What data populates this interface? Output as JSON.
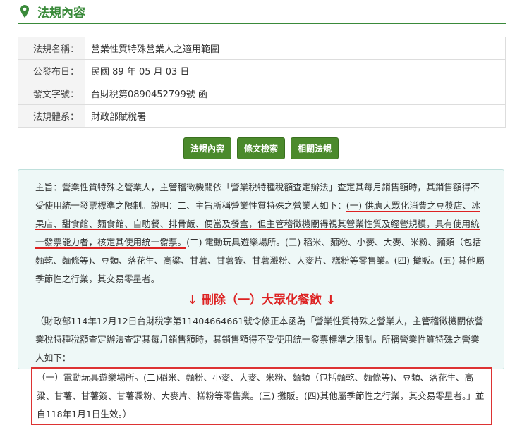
{
  "header": {
    "title": "法規內容",
    "icon": "map-pin-icon"
  },
  "info": [
    {
      "label": "法規名稱：",
      "value": "營業性質特殊營業人之適用範圍"
    },
    {
      "label": "公發布日：",
      "value": "民國 89 年 05 月 03 日"
    },
    {
      "label": "發文字號：",
      "value": "台財稅第0890452799號 函"
    },
    {
      "label": "法規體系：",
      "value": "財政部賦稅署"
    }
  ],
  "buttons": [
    "法規內容",
    "條文檢索",
    "相關法規"
  ],
  "content": {
    "p1a": "主旨：營業性質特殊之營業人，主管稽徵機關依「營業稅特種稅額查定辦法」查定其每月銷售額時，其銷售額得不受使用統一發票標準之限制。說明：二、主旨所稱營業性質特殊之營業人如下：",
    "p1u": "(一) 供應大眾化消費之豆漿店、冰果店、甜食館、麵食館、自助餐、排骨飯、便當及餐盒，但主管稽徵機關得視其營業性質及經營規模，具有使用統一發票能力者，核定其使用統一發票。",
    "p1b": "(二) 電動玩具遊樂場所。(三) 稻米、麵粉、小麥、大麥、米粉、麵類（包括麵乾、麵條等)、豆類、落花生、高粱、甘薯、甘薯簽、甘薯澱粉、大麥片、糕粉等零售業。(四) 攤販。(五) 其他屬季節性之行業，其交易零星者。",
    "annotation": "↓ 刪除（一）大眾化餐飲 ↓",
    "p2a": "（財政部114年12月12日台財稅字第11404664661號令修正本函為「營業性質特殊之營業人，主管稽徵機關依營業稅特種稅額查定辦法查定其每月銷售額時，其銷售額得不受使用統一發票標準之限制。所稱營業性質特殊之營業人如下：",
    "p2box": "（一）電動玩具遊樂場所。(二)稻米、麵粉、小麥、大麥、米粉、麵類（包括麵乾、麵條等)、豆類、落花生、高粱、甘薯、甘薯簽、甘薯澱粉、大麥片、糕粉等零售業。(三) 攤販。(四)其他屬季節性之行業，其交易零星者。」並自118年1月1日生效。）"
  }
}
